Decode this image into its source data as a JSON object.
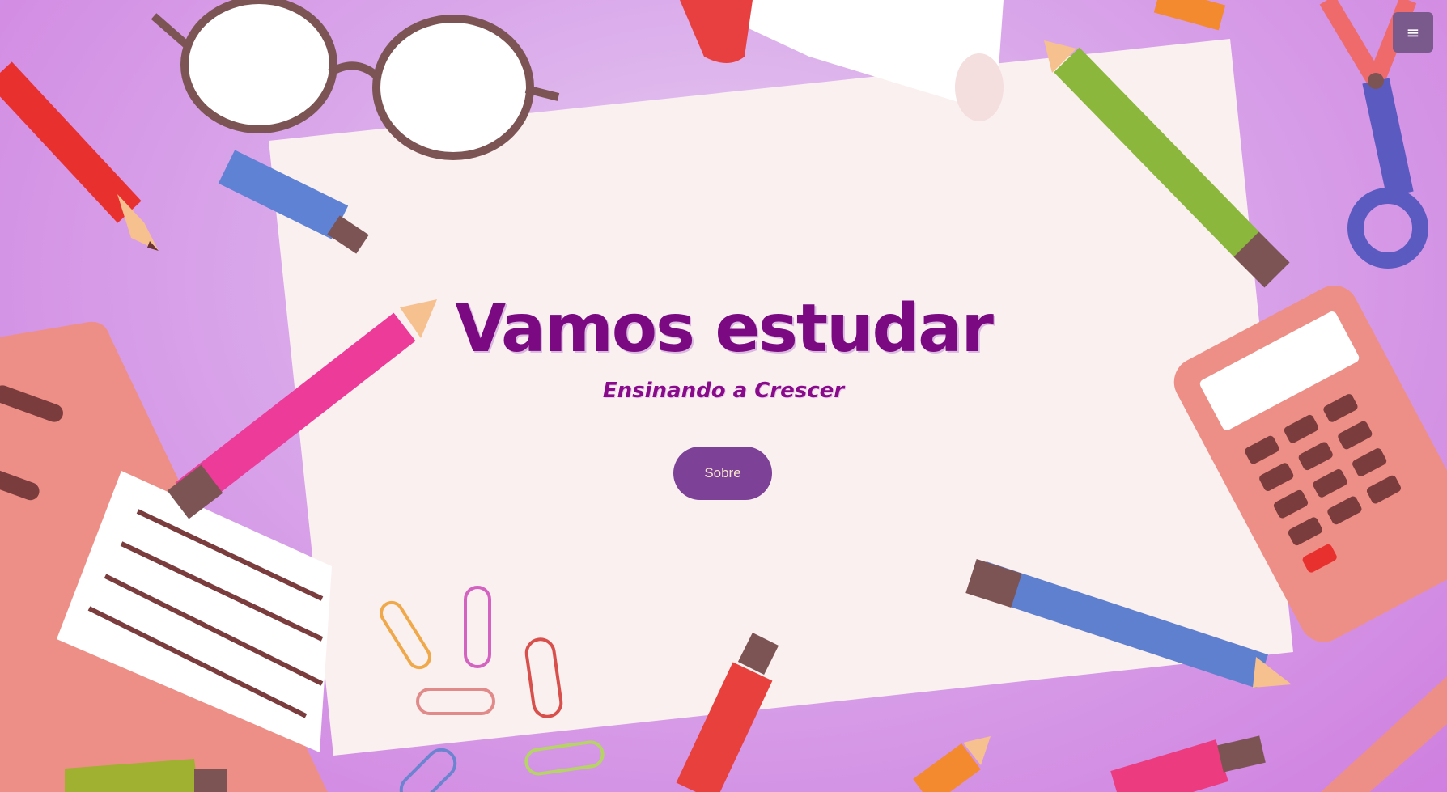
{
  "hero": {
    "title": "Vamos estudar",
    "subtitle": "Ensinando a Crescer",
    "cta_label": "Sobre"
  },
  "navbar": {
    "menu_icon": "hamburger-menu-icon",
    "menu_glyph": "≡"
  },
  "colors": {
    "title": "#7b0a82",
    "button": "#7d4197",
    "button_text": "#f6e6c8",
    "menu_button": "#7a5a8c",
    "background": "#d9a6ea",
    "paper": "#fbf0f0"
  },
  "illustration": {
    "items": [
      "glasses",
      "rolled-paper-scroll",
      "blue-marker",
      "red-pencil",
      "green-pencil",
      "pink-pencil",
      "blue-pencil",
      "orange-pencil",
      "scissors",
      "calculator",
      "notebook",
      "paper-clips",
      "red-marker",
      "pink-marker",
      "ruler",
      "green-marker"
    ]
  }
}
